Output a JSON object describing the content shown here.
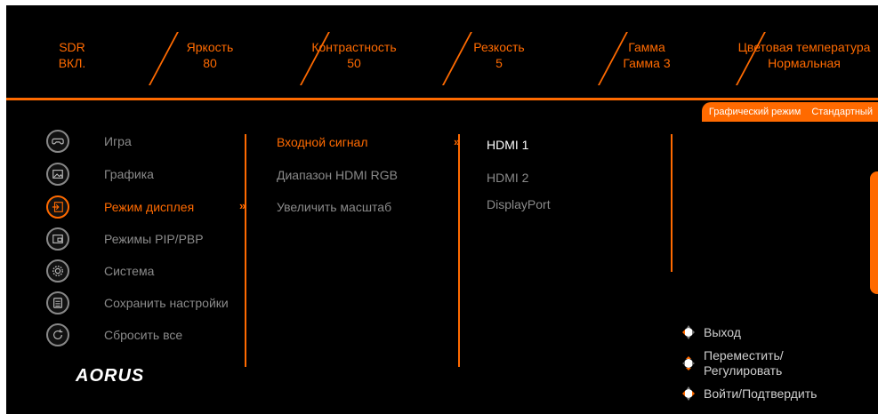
{
  "status": [
    {
      "label": "SDR",
      "value": "ВКЛ."
    },
    {
      "label": "Яркость",
      "value": "80"
    },
    {
      "label": "Контрастность",
      "value": "50"
    },
    {
      "label": "Резкость",
      "value": "5"
    },
    {
      "label": "Гамма",
      "value": "Гамма 3"
    },
    {
      "label": "Цветовая температура",
      "value": "Нормальная"
    }
  ],
  "mode_bar": {
    "label": "Графический режим",
    "value": "Стандартный"
  },
  "menu": [
    {
      "label": "Игра",
      "icon": "gamepad-icon"
    },
    {
      "label": "Графика",
      "icon": "picture-icon"
    },
    {
      "label": "Режим дисплея",
      "icon": "input-icon"
    },
    {
      "label": "Режимы PIP/PBP",
      "icon": "pip-icon"
    },
    {
      "label": "Система",
      "icon": "gear-icon"
    },
    {
      "label": "Сохранить настройки",
      "icon": "save-icon"
    },
    {
      "label": "Сбросить все",
      "icon": "reset-icon"
    }
  ],
  "submenu": [
    {
      "label": "Входной сигнал"
    },
    {
      "label": "Диапазон HDMI RGB"
    },
    {
      "label": "Увеличить масштаб"
    }
  ],
  "options": [
    {
      "label": "HDMI 1"
    },
    {
      "label": "HDMI 2"
    },
    {
      "label": "DisplayPort"
    }
  ],
  "help": {
    "exit": "Выход",
    "move": "Переместить/\nРегулировать",
    "enter": "Войти/Подтвердить"
  },
  "brand": "AORUS",
  "colors": {
    "accent": "#ff6a00",
    "background": "#000000",
    "inactive": "#8a8a8a"
  }
}
